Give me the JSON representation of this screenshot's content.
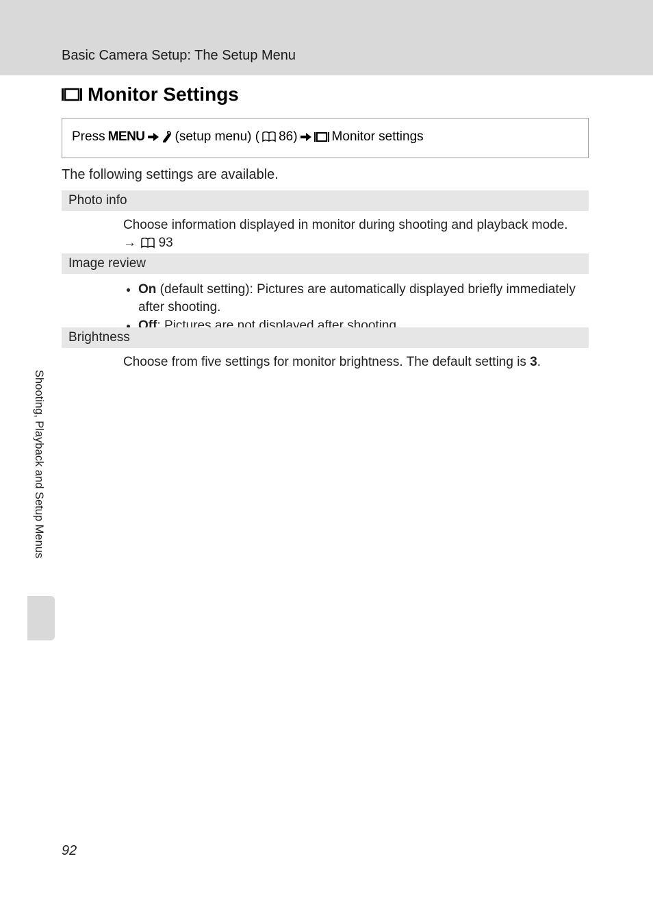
{
  "breadcrumb": "Basic Camera Setup: The Setup Menu",
  "heading": "Monitor Settings",
  "path": {
    "prefix": "Press",
    "menu_label": "MENU",
    "setup_menu_text": "(setup menu) (",
    "page_ref_1": "86)",
    "monitor_text": "Monitor settings"
  },
  "intro": "The following settings are available.",
  "sections": {
    "photo_info": {
      "header": "Photo info",
      "body": "Choose information displayed in monitor during shooting and playback mode.",
      "ref_arrow": "→",
      "ref_page": "93"
    },
    "image_review": {
      "header": "Image review",
      "items": [
        {
          "label": "On",
          "suffix": " (default setting): Pictures are automatically displayed briefly immediately after shooting."
        },
        {
          "label": "Off",
          "suffix": ": Pictures are not displayed after shooting."
        }
      ]
    },
    "brightness": {
      "header": "Brightness",
      "text_before": "Choose from five settings for monitor brightness. The default setting is ",
      "default_value": "3",
      "text_after": "."
    }
  },
  "side_label": "Shooting, Playback and Setup Menus",
  "page_number": "92"
}
